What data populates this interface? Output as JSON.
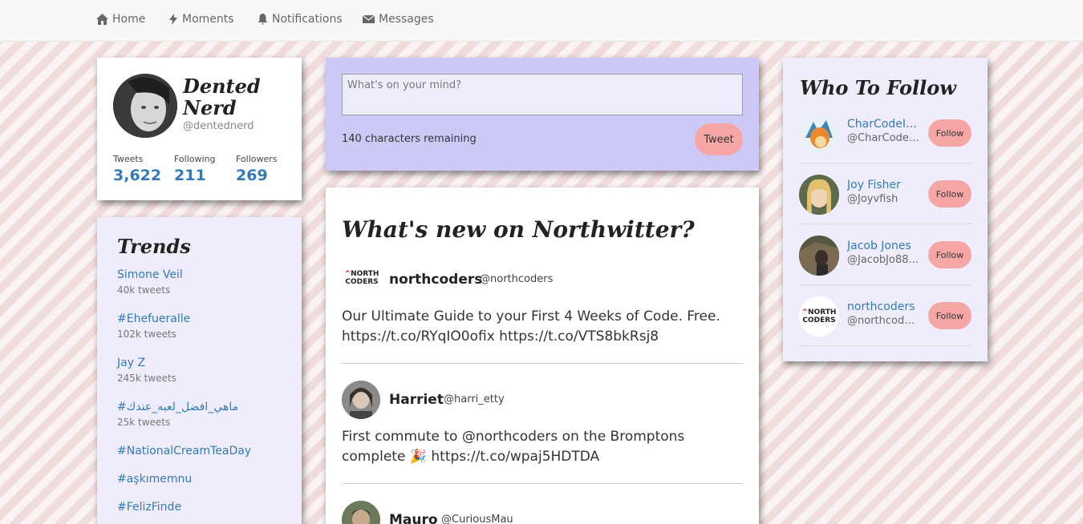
{
  "nav": {
    "home": "Home",
    "moments": "Moments",
    "notifications": "Notifications",
    "messages": "Messages"
  },
  "profile": {
    "name": "Dented Nerd",
    "handle": "@dentednerd",
    "stats": [
      {
        "label": "Tweets",
        "value": "3,622"
      },
      {
        "label": "Following",
        "value": "211"
      },
      {
        "label": "Followers",
        "value": "269"
      }
    ]
  },
  "trends": {
    "title": "Trends",
    "items": [
      {
        "name": "Simone Veil",
        "count": "40k tweets"
      },
      {
        "name": "#Ehefueralle",
        "count": "102k tweets"
      },
      {
        "name": "Jay Z",
        "count": "245k tweets"
      },
      {
        "name": "#ماهي_افضل_لعبه_عندك",
        "count": "25k tweets"
      },
      {
        "name": "#NationalCreamTeaDay",
        "count": ""
      },
      {
        "name": "#aşkımemnu",
        "count": ""
      },
      {
        "name": "#FelizFinde",
        "count": ""
      }
    ]
  },
  "compose": {
    "placeholder": "What's on your mind?",
    "remaining": "140 characters remaining",
    "button": "Tweet"
  },
  "feed": {
    "title": "What's new on Northwitter?",
    "tweets": [
      {
        "author": "northcoders",
        "handle": "@northcoders",
        "text": "Our Ultimate Guide to your First 4 Weeks of Code. Free. https://t.co/RYqIO0ofix https://t.co/VTS8bkRsj8"
      },
      {
        "author": "Harriet",
        "handle": "@harri_etty",
        "text": "First commute to @northcoders on the Bromptons complete 🎉 https://t.co/wpaj5HDTDA"
      },
      {
        "author": "Mauro",
        "handle": "@CuriousMau",
        "text": ""
      }
    ]
  },
  "who_to_follow": {
    "title": "Who To Follow",
    "follow_label": "Follow",
    "users": [
      {
        "name": "CharCodeIz...",
        "handle": "@CharCodei..."
      },
      {
        "name": "Joy Fisher",
        "handle": "@Joyvfish"
      },
      {
        "name": "Jacob Jones",
        "handle": "@JacobJo88..."
      },
      {
        "name": "northcoders",
        "handle": "@northcode..."
      }
    ]
  },
  "logo": {
    "line1": "NORTH",
    "line2": "CODERS"
  },
  "colors": {
    "link": "#337ab7",
    "button": "#f7a6a6",
    "compose_bg": "#ccc9f7",
    "panel_lavender": "#efedfb"
  }
}
